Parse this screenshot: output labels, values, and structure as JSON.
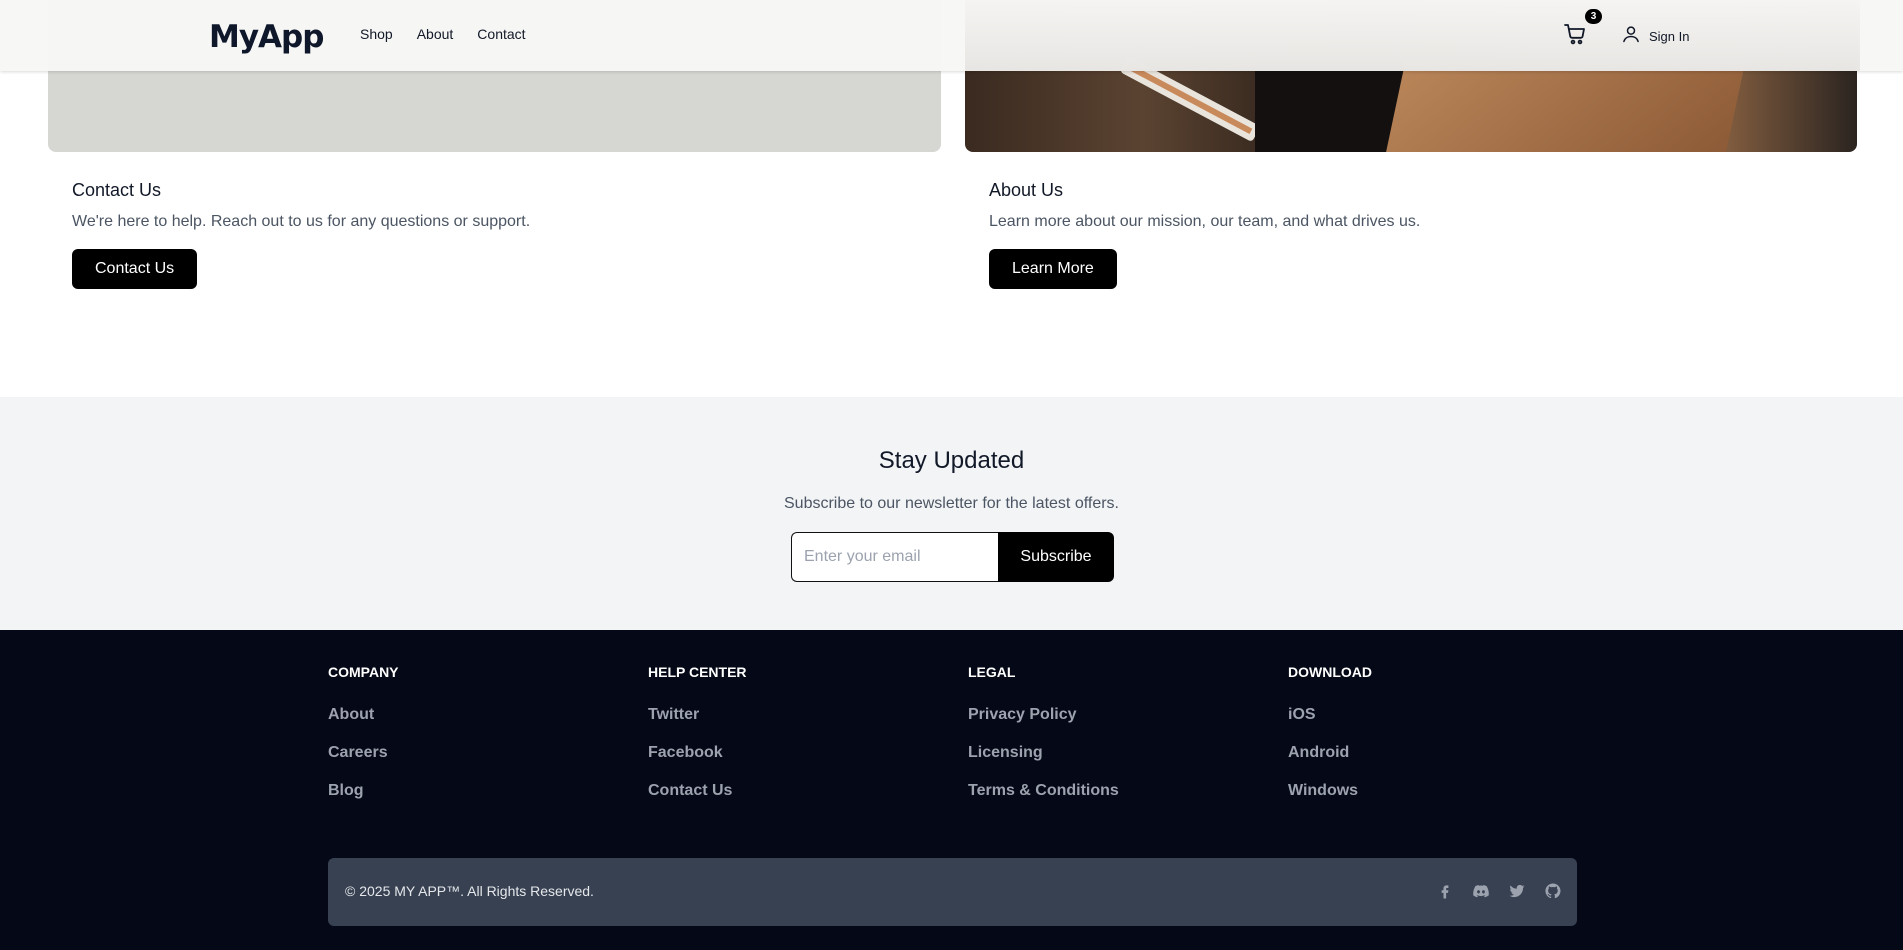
{
  "header": {
    "logo": "MyApp",
    "nav": [
      "Shop",
      "About",
      "Contact"
    ],
    "cart_count": "3",
    "signin_label": "Sign In"
  },
  "cards": [
    {
      "title": "Contact Us",
      "description": "We're here to help. Reach out to us for any questions or support.",
      "button": "Contact Us"
    },
    {
      "title": "About Us",
      "description": "Learn more about our mission, our team, and what drives us.",
      "button": "Learn More"
    }
  ],
  "newsletter": {
    "title": "Stay Updated",
    "subtitle": "Subscribe to our newsletter for the latest offers.",
    "placeholder": "Enter your email",
    "button": "Subscribe"
  },
  "footer": {
    "columns": [
      {
        "heading": "COMPANY",
        "links": [
          "About",
          "Careers",
          "Blog"
        ]
      },
      {
        "heading": "HELP CENTER",
        "links": [
          "Twitter",
          "Facebook",
          "Contact Us"
        ]
      },
      {
        "heading": "LEGAL",
        "links": [
          "Privacy Policy",
          "Licensing",
          "Terms & Conditions"
        ]
      },
      {
        "heading": "DOWNLOAD",
        "links": [
          "iOS",
          "Android",
          "Windows"
        ]
      }
    ],
    "copyright": "© 2025 MY APP™. All Rights Reserved.",
    "socials": [
      "facebook-icon",
      "discord-icon",
      "twitter-icon",
      "github-icon"
    ]
  },
  "colors": {
    "footer_bg": "#050816",
    "footer_bar": "#374151",
    "newsletter_bg": "#f3f4f6",
    "button": "#000000"
  }
}
